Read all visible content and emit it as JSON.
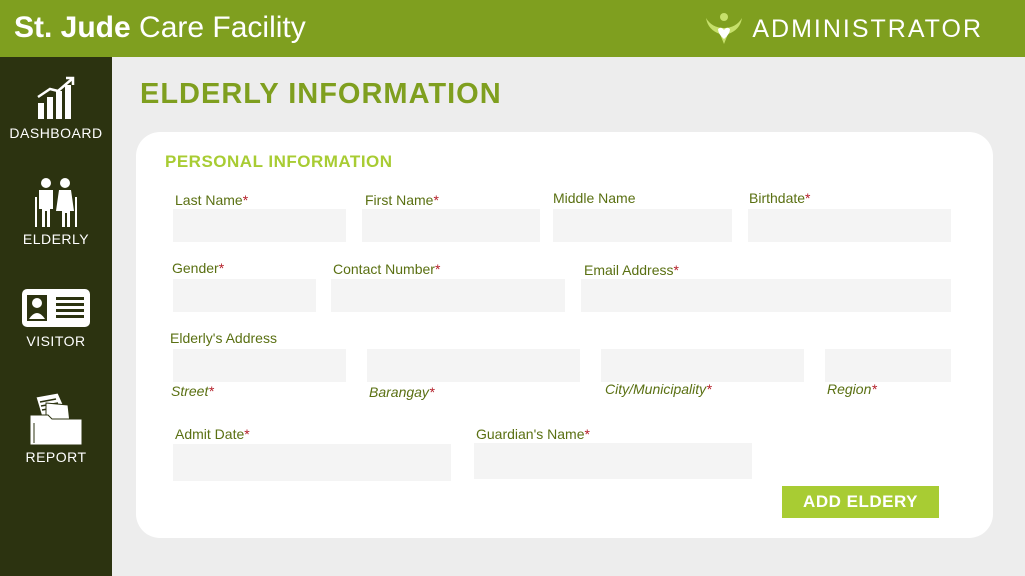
{
  "header": {
    "brand_bold": "St. Jude",
    "brand_rest": "Care Facility",
    "role_label": "ADMINISTRATOR",
    "logo_icon": "hands-heart-icon",
    "bg_color": "#7f9f1f"
  },
  "sidebar": {
    "bg_color": "#2c3310",
    "items": [
      {
        "label": "DASHBOARD",
        "icon": "chart-growth-icon"
      },
      {
        "label": "ELDERLY",
        "icon": "elderly-couple-icon"
      },
      {
        "label": "VISITOR",
        "icon": "id-card-icon"
      },
      {
        "label": "REPORT",
        "icon": "documents-folder-icon"
      }
    ]
  },
  "main": {
    "page_title": "ELDERLY INFORMATION",
    "section_title": "PERSONAL INFORMATION",
    "required_mark": "*",
    "fields": {
      "last_name": {
        "label": "Last Name",
        "value": ""
      },
      "first_name": {
        "label": "First Name",
        "value": ""
      },
      "middle_name": {
        "label": "Middle Name",
        "value": ""
      },
      "birthdate": {
        "label": "Birthdate",
        "value": ""
      },
      "gender": {
        "label": "Gender",
        "value": ""
      },
      "contact_number": {
        "label": "Contact Number",
        "value": ""
      },
      "email_address": {
        "label": "Email Address",
        "value": ""
      },
      "address_label": "Elderly's Address",
      "street": {
        "label": "Street",
        "value": ""
      },
      "barangay": {
        "label": "Barangay",
        "value": ""
      },
      "city": {
        "label": "City/Municipality",
        "value": ""
      },
      "region": {
        "label": "Region",
        "value": ""
      },
      "admit_date": {
        "label": "Admit Date",
        "value": ""
      },
      "guardian_name": {
        "label": "Guardian's Name",
        "value": ""
      }
    },
    "submit_label": "ADD ELDERY",
    "accent_color": "#a8cc33"
  }
}
